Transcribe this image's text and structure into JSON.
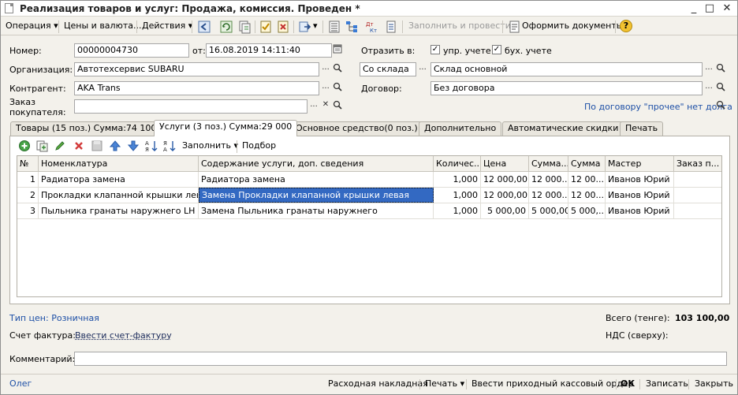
{
  "window": {
    "title": "Реализация товаров и услуг: Продажа, комиссия. Проведен *",
    "minimize": "_",
    "restore": "□",
    "close": "✕"
  },
  "toolbar": {
    "operation": "Операция",
    "prices": "Цены и валюта...",
    "actions": "Действия",
    "fill_and_post": "Заполнить и провести",
    "make_docs": "Оформить документы",
    "help": "?"
  },
  "form": {
    "number_label": "Номер:",
    "number_value": "00000004730",
    "date_label": "от:",
    "date_value": "16.08.2019 14:11:40",
    "reflect_label": "Отразить в:",
    "mgmt_label": "упр. учете",
    "acct_label": "бух. учете",
    "org_label": "Организация:",
    "org_value": "Автотехсервис SUBARU",
    "from_warehouse_value": "Со склада",
    "warehouse_value": "Склад основной",
    "contractor_label": "Контрагент:",
    "contractor_value": "AKA Trans",
    "contract_label": "Договор:",
    "contract_value": "Без договора",
    "order_label_1": "Заказ",
    "order_label_2": "покупателя:",
    "order_value": "",
    "debt_note": "По договору \"прочее\" нет долга",
    "ellipsis": "...",
    "lookup": "Q",
    "clear": "✕",
    "check": "✓"
  },
  "tabs": [
    {
      "label": "Товары (15 поз.) Сумма:74 100"
    },
    {
      "label": "Услуги (3 поз.) Сумма:29 000"
    },
    {
      "label": "Основное средство(0 поз.)"
    },
    {
      "label": "Дополнительно"
    },
    {
      "label": "Автоматические скидки"
    },
    {
      "label": "Печать"
    }
  ],
  "grid_toolbar": {
    "fill": "Заполнить",
    "select": "Подбор"
  },
  "grid": {
    "columns": [
      "№",
      "Номенклатура",
      "Содержание услуги, доп. сведения",
      "Количес...",
      "Цена",
      "Сумма...",
      "Сумма",
      "Мастер",
      "Заказ п..."
    ],
    "rows": [
      [
        "1",
        "Радиатора замена",
        "Радиатора замена",
        "1,000",
        "12 000,00",
        "12 000...",
        "12 00...",
        "Иванов Юрий",
        ""
      ],
      [
        "2",
        "Прокладки клапанной крышки лева...",
        "Замена Прокладки клапанной крышки левая",
        "1,000",
        "12 000,00",
        "12 000...",
        "12 00...",
        "Иванов Юрий",
        ""
      ],
      [
        "3",
        "Пыльника гранаты наружнего LH з...",
        "Замена Пыльника гранаты наружнего",
        "1,000",
        "5 000,00",
        "5 000,00",
        "5 000,...",
        "Иванов Юрий",
        ""
      ]
    ]
  },
  "footer": {
    "price_type": "Тип цен: Розничная",
    "total_label": "Всего (тенге):",
    "total_value": "103 100,00",
    "invoice_label": "Счет фактура:",
    "invoice_link": "Ввести счет-фактуру",
    "vat_label": "НДС (сверху):",
    "comment_label": "Комментарий:",
    "comment_value": ""
  },
  "bottom": {
    "user": "Олег",
    "waybill": "Расходная накладная",
    "print": "Печать",
    "cash_order": "Ввести приходный кассовый ордер",
    "ok": "OK",
    "save": "Записать",
    "close": "Закрыть"
  },
  "colors": {
    "accent_blue": "#3369c2",
    "link": "#1d4fa6",
    "background": "#f3f1eb"
  }
}
